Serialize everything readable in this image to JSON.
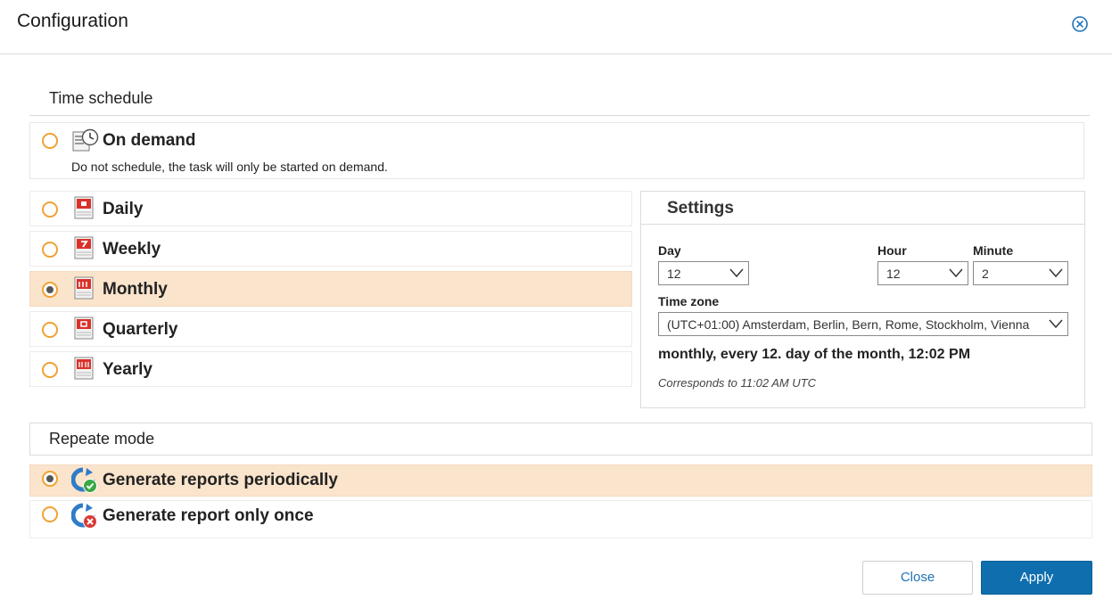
{
  "header": {
    "title": "Configuration"
  },
  "time_schedule": {
    "heading": "Time schedule",
    "on_demand": {
      "label": "On demand",
      "description": "Do not schedule, the task will only be started on demand.",
      "selected": false
    },
    "options": [
      {
        "label": "Daily",
        "selected": false
      },
      {
        "label": "Weekly",
        "selected": false
      },
      {
        "label": "Monthly",
        "selected": true
      },
      {
        "label": "Quarterly",
        "selected": false
      },
      {
        "label": "Yearly",
        "selected": false
      }
    ]
  },
  "settings": {
    "title": "Settings",
    "day_label": "Day",
    "day_value": "12",
    "hour_label": "Hour",
    "hour_value": "12",
    "minute_label": "Minute",
    "minute_value": "2",
    "timezone_label": "Time zone",
    "timezone_value": "(UTC+01:00) Amsterdam, Berlin, Bern, Rome, Stockholm, Vienna",
    "summary": "monthly, every 12. day of the month, 12:02 PM",
    "corresponds": "Corresponds to 11:02 AM UTC"
  },
  "repeat_mode": {
    "heading": "Repeate mode",
    "options": [
      {
        "label": "Generate reports periodically",
        "selected": true,
        "icon": "refresh-check-icon"
      },
      {
        "label": "Generate report only once",
        "selected": false,
        "icon": "refresh-cross-icon"
      }
    ]
  },
  "buttons": {
    "close_label": "Close",
    "apply_label": "Apply"
  },
  "colors": {
    "accent": "#f0a232",
    "selected_row": "#fbe4cc",
    "primary_button": "#0f6fae",
    "link": "#1e73b8"
  }
}
